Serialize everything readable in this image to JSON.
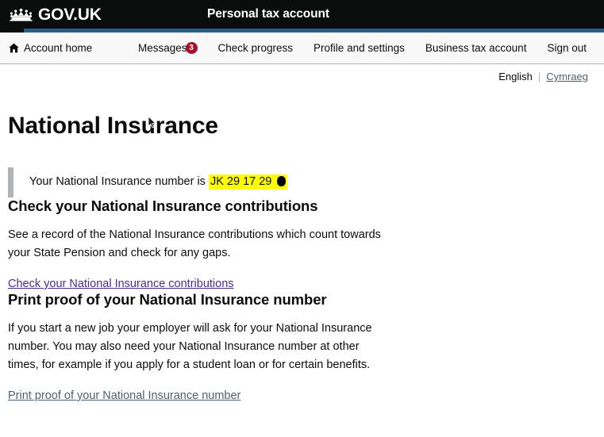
{
  "header": {
    "logo_text": "GOV.UK",
    "crown_icon": "crown-icon",
    "service_name": "Personal tax account"
  },
  "nav": {
    "home_icon": "home-icon",
    "home_label": "Account home",
    "items": [
      {
        "label": "Messages",
        "badge": "3"
      },
      {
        "label": "Check progress",
        "badge": null
      },
      {
        "label": "Profile and settings",
        "badge": null
      },
      {
        "label": "Business tax account",
        "badge": null
      },
      {
        "label": "Sign out",
        "badge": null
      }
    ]
  },
  "language": {
    "current": "English",
    "separator": "|",
    "alternate": "Cymraeg"
  },
  "main": {
    "page_title": "National Insurance",
    "inset": {
      "prefix": "Your National Insurance number is ",
      "ni_number": "JK 29 17 29",
      "redacted_suffix": "redaction-block"
    },
    "sections": [
      {
        "heading": "Check your National Insurance contributions",
        "body": "See a record of the National Insurance contributions which count towards your State Pension and check for any gaps.",
        "link": "Check your National Insurance contributions"
      },
      {
        "heading": "Print proof of your National Insurance number",
        "body": "If you start a new job your employer will ask for your National Insurance number. You may also need your National Insurance number at other times, for example if you apply for a student loan or for certain benefits.",
        "link": "Print proof of your National Insurance number"
      }
    ]
  },
  "colors": {
    "header_black": "#0b0c0c",
    "accent_blue": "#2b5c8a",
    "badge_red": "#a8102a",
    "highlight_yellow": "#ffff00",
    "link_blue": "#4c6272",
    "link_visited": "#4c2c92",
    "nav_background": "#f8f8f8",
    "inset_border_grey": "#b1b4b6"
  }
}
